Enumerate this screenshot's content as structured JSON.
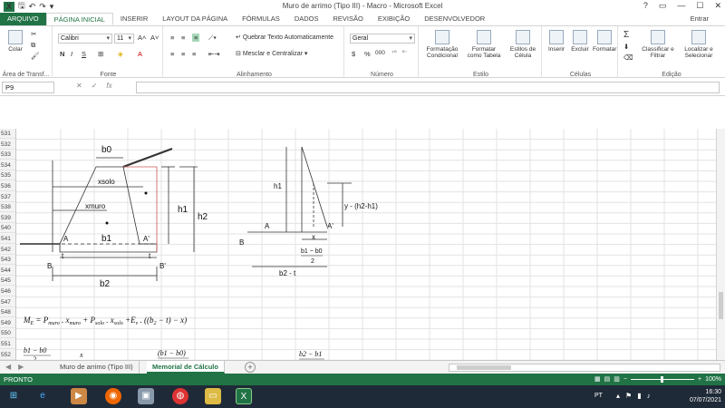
{
  "window": {
    "title": "Muro de arrimo (Tipo III) - Macro - Microsoft Excel",
    "help": "?",
    "signin": "Entrar"
  },
  "quick_access": {
    "app_icon": "X",
    "save": "🖫",
    "undo": "↶",
    "redo": "↷",
    "customize": "▾"
  },
  "tabs": [
    "ARQUIVO",
    "PÁGINA INICIAL",
    "INSERIR",
    "LAYOUT DA PÁGINA",
    "FÓRMULAS",
    "DADOS",
    "REVISÃO",
    "EXIBIÇÃO",
    "DESENVOLVEDOR"
  ],
  "ribbon": {
    "clipboard": {
      "label": "Área de Transf...",
      "paste": "Colar"
    },
    "font": {
      "label": "Fonte",
      "name": "Calibri",
      "size": "11",
      "bold": "N",
      "italic": "I",
      "underline": "S"
    },
    "alignment": {
      "label": "Alinhamento",
      "wrap": "Quebrar Texto Automaticamente",
      "merge": "Mesclar e Centralizar"
    },
    "number": {
      "label": "Número",
      "format": "Geral",
      "currency": "$",
      "percent": "%",
      "thousands": "000"
    },
    "styles": {
      "label": "Estilo",
      "conditional": "Formatação Condicional",
      "table": "Formatar como Tabela",
      "cell": "Estilos de Célula"
    },
    "cells": {
      "label": "Células",
      "insert": "Inserir",
      "delete": "Excluir",
      "format": "Formatar"
    },
    "editing": {
      "label": "Edição",
      "sort": "Classificar e Filtrar",
      "find": "Localizar e Selecionar"
    }
  },
  "formula_bar": {
    "name_box": "P9",
    "cancel": "✕",
    "enter": "✓",
    "fx": "fx",
    "value": ""
  },
  "columns": [
    "A",
    "B",
    "C",
    "D",
    "E",
    "F",
    "G",
    "H",
    "I",
    "J",
    "K",
    "L",
    "M",
    "N",
    "O",
    "P",
    "Q",
    "R",
    "S",
    "T"
  ],
  "selected_column": "P",
  "rows": [
    "531",
    "532",
    "533",
    "534",
    "535",
    "536",
    "537",
    "538",
    "539",
    "540",
    "541",
    "542",
    "543",
    "544",
    "545",
    "546",
    "547",
    "548",
    "549",
    "550",
    "551",
    "552"
  ],
  "drawing_labels": {
    "b0": "b0",
    "xsolo": "xsolo",
    "xmuro": "xmuro",
    "h1": "h1",
    "h2": "h2",
    "b1": "b1",
    "A": "A",
    "A_prime": "A'",
    "t": "t",
    "B": "B",
    "B_prime": "B'",
    "b2": "b2",
    "h1_right": "h1",
    "y_label": "y - (h2-h1)",
    "A_right": "A",
    "A_prime_right": "A'",
    "B_right": "B",
    "x_right": "x",
    "frac_top": "b1 − b0",
    "frac_bottom": "2",
    "b2t": "b2 - t"
  },
  "equation": "M",
  "equation_sub": "E",
  "equation_rest": " = P",
  "equation_parts": [
    "muro",
    " . x",
    "muro",
    " + P",
    "solo",
    " . x",
    "solo",
    " +E",
    "v",
    " . ((b",
    "2",
    " − t) − x)"
  ],
  "row551": {
    "frac1_top": "b1 − b0",
    "frac1_bottom": "2",
    "x": "x",
    "frac2_top": "(b1 − b0)",
    "frac3_top": "b2 − b1"
  },
  "sheets": [
    "Muro de arrimo (Tipo III)",
    "Memorial de Cálculo"
  ],
  "active_sheet": "Memorial de Cálculo",
  "status": {
    "ready": "PRONTO",
    "zoom": "100%"
  },
  "taskbar": {
    "lang": "PT",
    "time": "16:30",
    "date": "07/07/2021"
  }
}
